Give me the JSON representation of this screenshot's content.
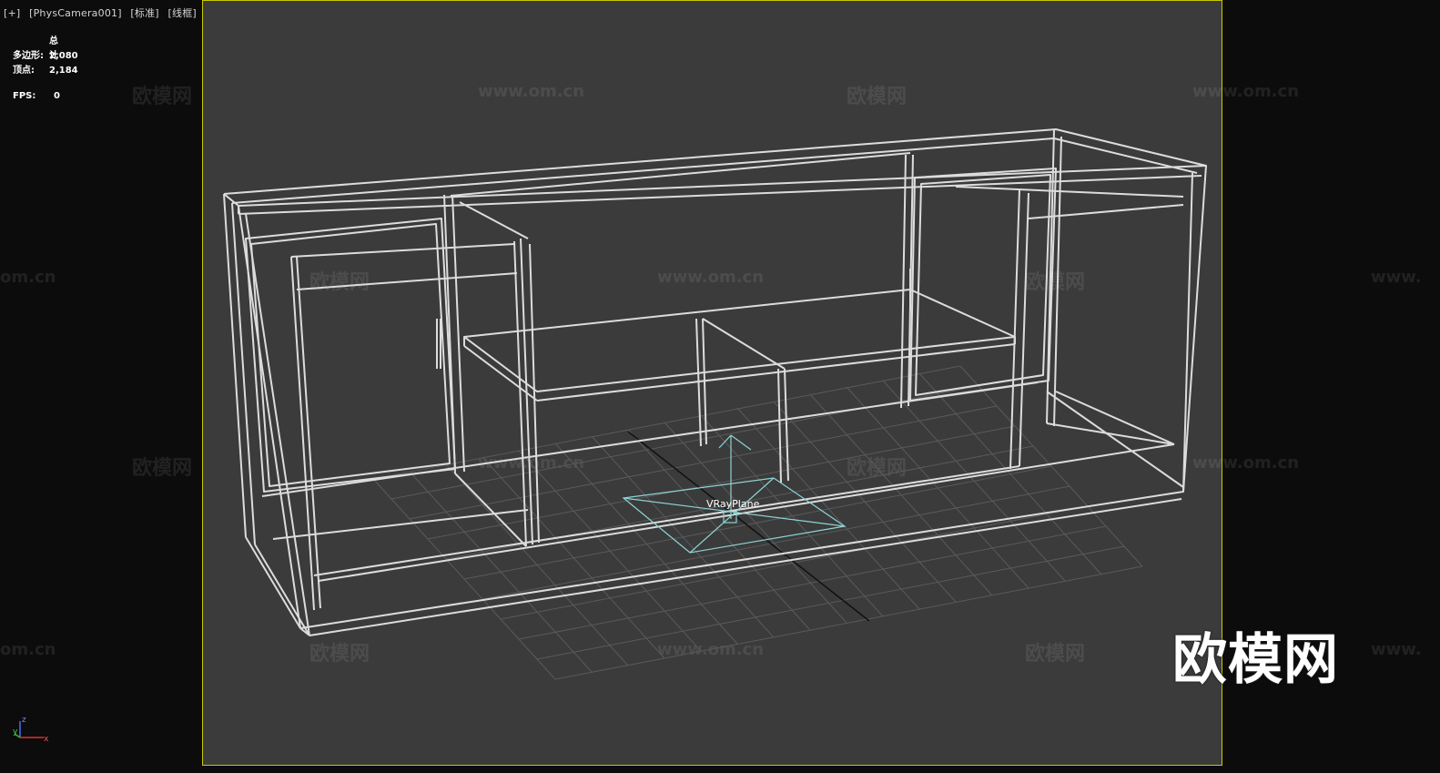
{
  "viewport_label": {
    "plus": "[+]",
    "camera": "[PhysCamera001]",
    "shading": "[标准]",
    "mode": "[线框]"
  },
  "stats": {
    "header": "总计",
    "polygons_label": "多边形:",
    "polygons_value": "2,080",
    "vertices_label": "顶点:",
    "vertices_value": "2,184",
    "fps_label": "FPS:",
    "fps_value": "0"
  },
  "scene": {
    "plane_label": "VRayPlane",
    "wire_color": "#d8d8d8",
    "grid_color": "#555555",
    "plane_color": "#8fd3d3",
    "viewport_border": "#c8c800"
  },
  "axis_tripod": {
    "z": "z",
    "y": "y",
    "x": "x"
  },
  "watermarks": {
    "site": "www.om.cn",
    "cn": "欧模网",
    "partial_site": "om.cn",
    "partial_www": "www."
  },
  "logo": "欧模网"
}
